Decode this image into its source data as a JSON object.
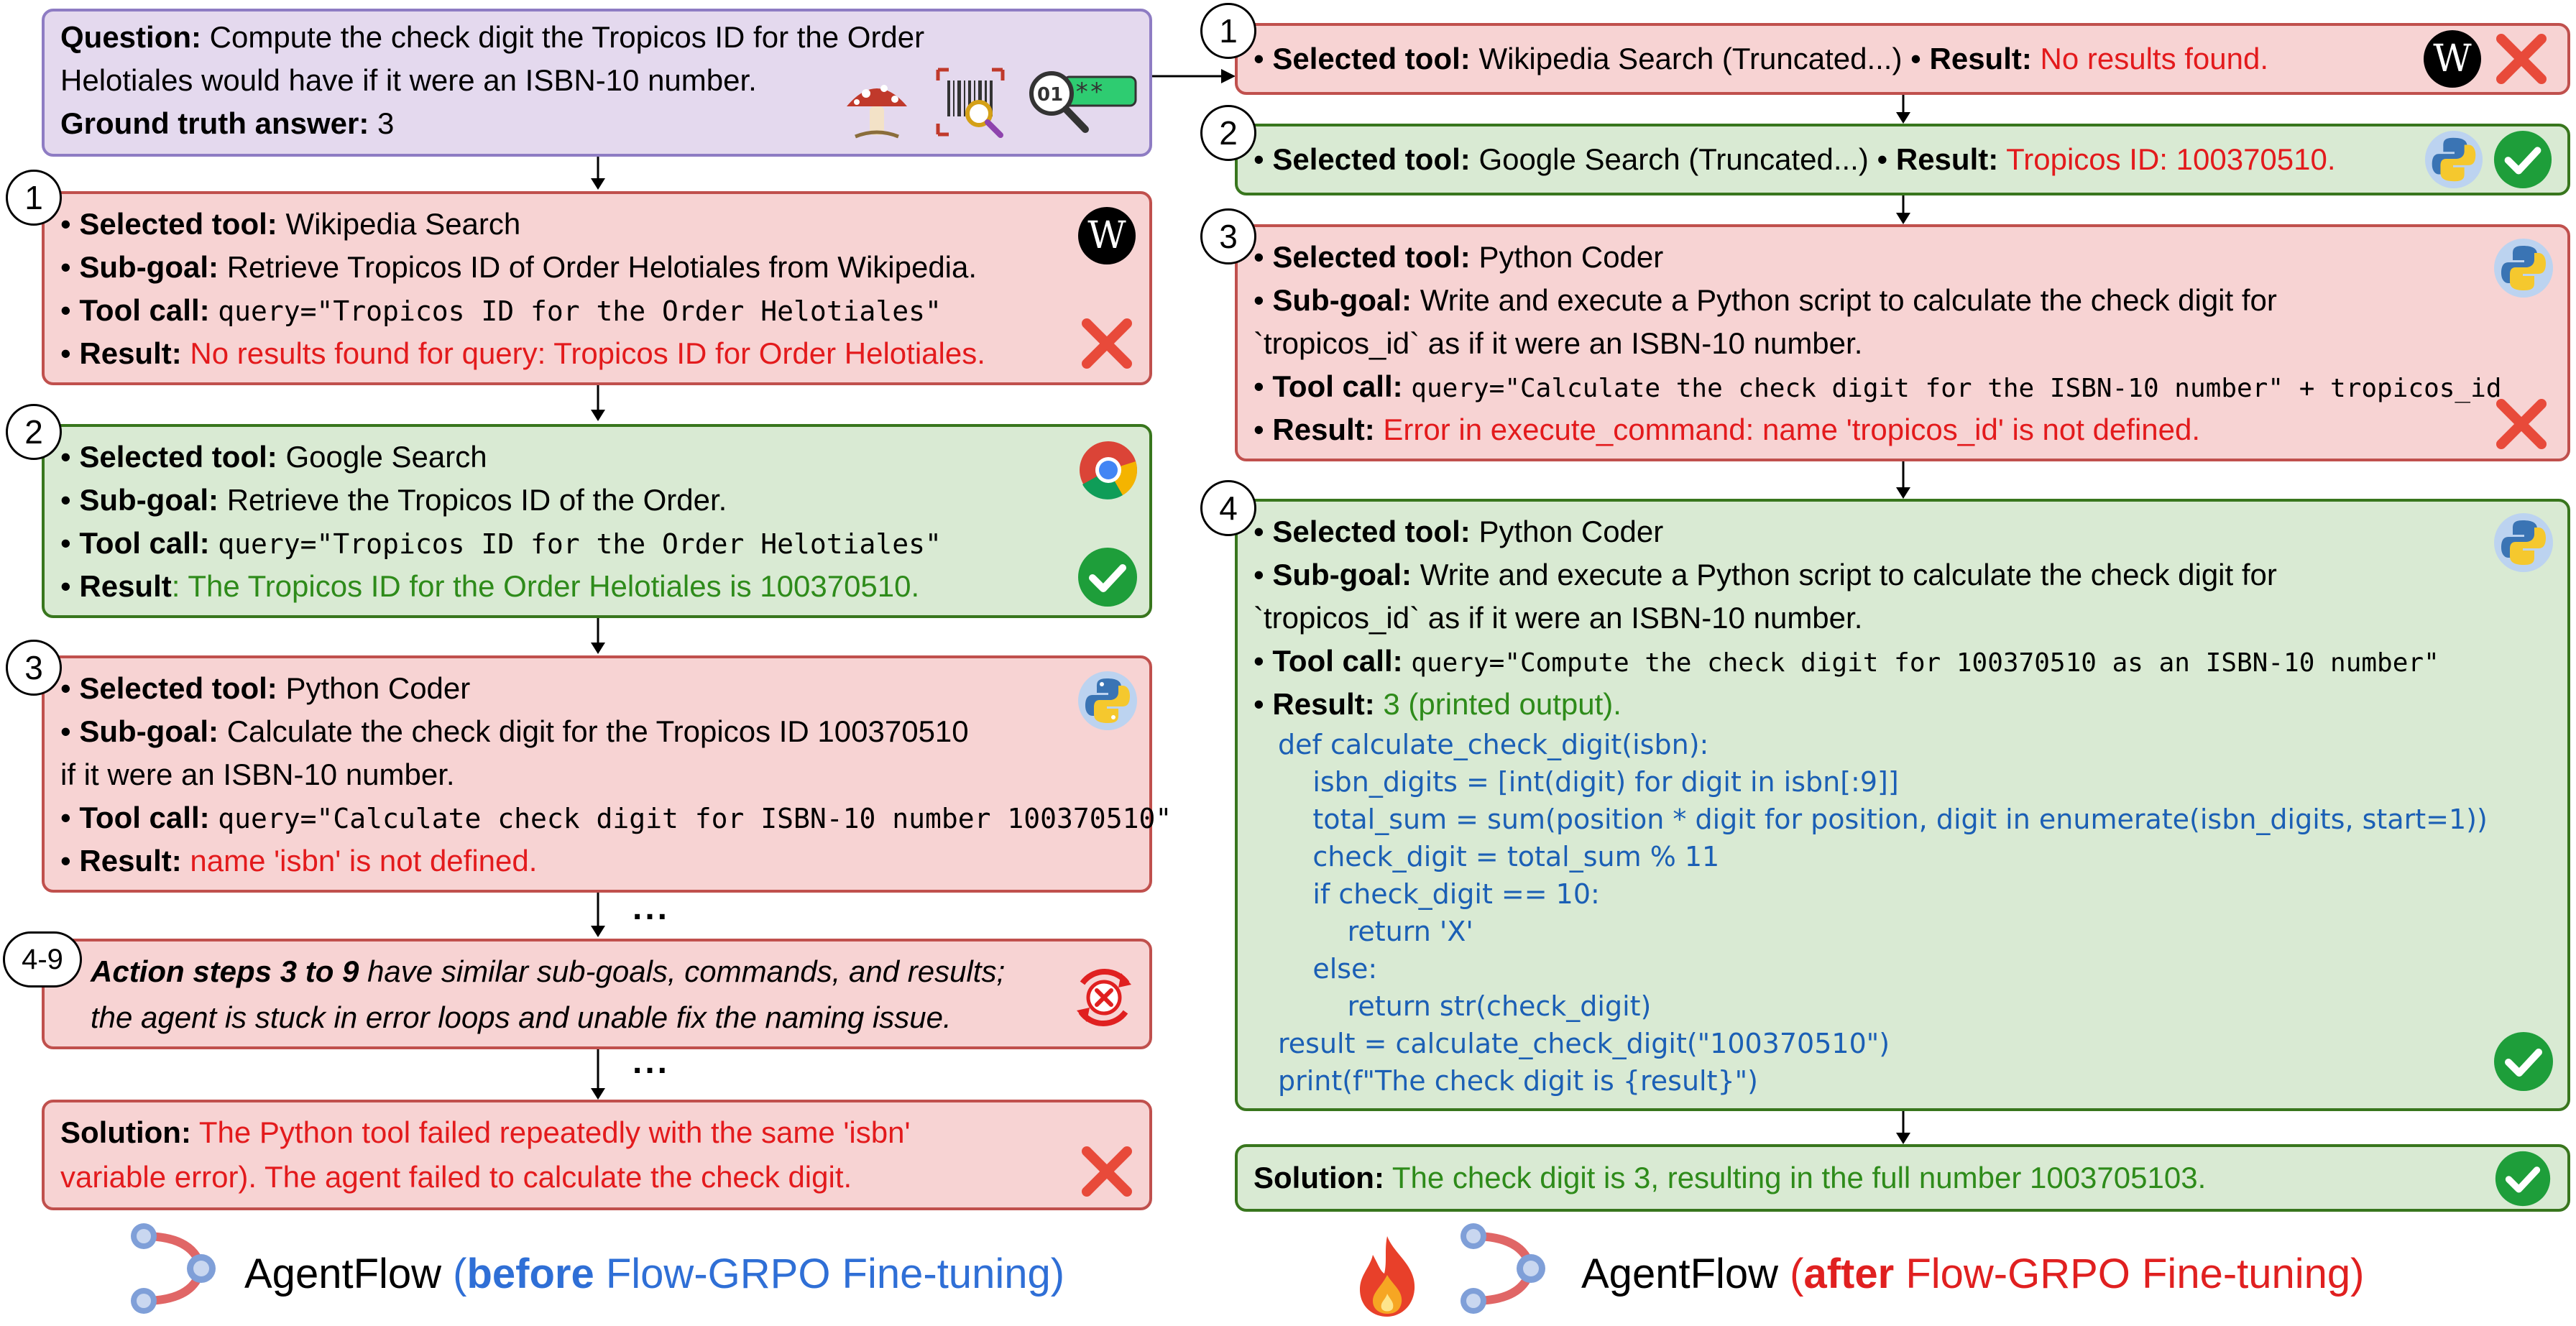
{
  "question": {
    "label": "Question:",
    "text1": "Compute the check digit the Tropicos ID for the Order",
    "text2": "Helotiales would have if it were an ISBN-10 number.",
    "gt_label": "Ground truth answer:",
    "gt_value": "3"
  },
  "left": {
    "steps": [
      {
        "num": "1",
        "tool_label": "Selected tool:",
        "tool": "Wikipedia Search",
        "sub_label": "Sub-goal:",
        "sub": "Retrieve Tropicos ID of Order Helotiales from Wikipedia.",
        "call_label": "Tool call:",
        "call": "query=\"Tropicos ID for the Order Helotiales\"",
        "res_label": "Result:",
        "res": "No results found for query: Tropicos ID for Order Helotiales."
      },
      {
        "num": "2",
        "tool_label": "Selected tool:",
        "tool": "Google Search",
        "sub_label": "Sub-goal:",
        "sub": "Retrieve the Tropicos ID of the Order.",
        "call_label": "Tool call:",
        "call": "query=\"Tropicos ID for the Order Helotiales\"",
        "res_label": "Result",
        "res": ": The Tropicos ID for the Order Helotiales is 100370510."
      },
      {
        "num": "3",
        "tool_label": "Selected tool:",
        "tool": "Python Coder",
        "sub_label": "Sub-goal:",
        "sub": "Calculate the check digit for the Tropicos ID 100370510",
        "sub2": "if it were an ISBN-10 number.",
        "call_label": "Tool call:",
        "call": "query=\"Calculate check digit for ISBN-10 number 100370510\"",
        "res_label": "Result:",
        "res": "name 'isbn' is not defined."
      }
    ],
    "loop": {
      "num": "4-9",
      "bold": "Action steps 3 to 9",
      "text1": " have similar sub-goals, commands, and results;",
      "text2": "the agent is stuck in error loops and unable fix the naming issue."
    },
    "solution": {
      "label": "Solution:",
      "text1": "The Python tool failed repeatedly with the same 'isbn'",
      "text2": "variable error). The agent failed to calculate the check digit."
    },
    "ellipsis": "...",
    "footer": {
      "brand": "AgentFlow",
      "open": "(",
      "bold": "before",
      "rest": " Flow-GRPO Fine-tuning)"
    }
  },
  "right": {
    "step1": {
      "num": "1",
      "tool_label": "Selected tool:",
      "tool": "Wikipedia Search (Truncated...)",
      "sep": " • ",
      "res_label": "Result:",
      "res": "No results found."
    },
    "step2": {
      "num": "2",
      "tool_label": "Selected tool:",
      "tool": "Google Search (Truncated...)",
      "sep": " • ",
      "res_label": "Result:",
      "res": "Tropicos ID: 100370510."
    },
    "step3": {
      "num": "3",
      "tool_label": "Selected tool:",
      "tool": "Python Coder",
      "sub_label": "Sub-goal:",
      "sub": "Write and execute a Python script to calculate the check digit for",
      "sub2": "`tropicos_id` as if it were an ISBN-10 number.",
      "call_label": "Tool call:",
      "call": "query=\"Calculate the check digit for the ISBN-10 number\" + tropicos_id",
      "res_label": "Result:",
      "res": "Error in execute_command: name 'tropicos_id' is not defined."
    },
    "step4": {
      "num": "4",
      "tool_label": "Selected tool:",
      "tool": "Python Coder",
      "sub_label": "Sub-goal:",
      "sub": "Write and execute a Python script to calculate the check digit for",
      "sub2": "`tropicos_id` as if it were an ISBN-10 number.",
      "call_label": "Tool call:",
      "call": "query=\"Compute the check digit for 100370510 as an ISBN-10 number\"",
      "res_label": "Result:",
      "res": "3 (printed output).",
      "code": [
        "def calculate_check_digit(isbn):",
        "    isbn_digits = [int(digit) for digit in isbn[:9]]",
        "    total_sum = sum(position * digit for position, digit in enumerate(isbn_digits, start=1))",
        "    check_digit = total_sum % 11",
        "    if check_digit == 10:",
        "        return 'X'",
        "    else:",
        "        return str(check_digit)",
        "result = calculate_check_digit(\"100370510\")",
        "print(f\"The check digit is {result}\")"
      ]
    },
    "solution": {
      "label": "Solution:",
      "text": "The check digit is 3, resulting in the full number 1003705103."
    },
    "footer": {
      "brand": "AgentFlow",
      "open": "(",
      "bold": "after",
      "rest": " Flow-GRPO Fine-tuning)"
    }
  },
  "icons": {
    "wikipedia": "W",
    "colors": {
      "red_box": "#f7d3d3",
      "green_box": "#d9ead3",
      "purple_box": "#e4d9ee",
      "error": "#e31a1c",
      "success": "#2e8b1a",
      "code": "#1b5fb5"
    }
  }
}
